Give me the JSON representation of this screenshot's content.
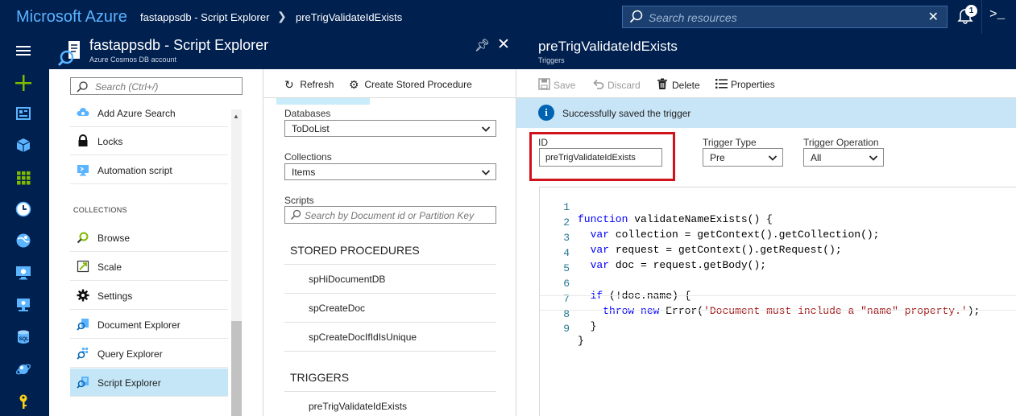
{
  "topbar": {
    "brand": "Microsoft Azure",
    "breadcrumb": [
      "fastappsdb - Script Explorer",
      "preTrigValidateIdExists"
    ],
    "search_placeholder": "Search resources",
    "notification_count": "1"
  },
  "leftnav": {
    "icons": [
      "hamburger-icon",
      "plus-icon",
      "dashboard-icon",
      "cube-icon",
      "grid-icon",
      "clock-icon",
      "globe-icon",
      "monitor-icon",
      "computer-icon",
      "sql-icon",
      "cosmos-icon",
      "key-icon"
    ],
    "colors": {
      "plus": "#7fba00",
      "key": "#fcd116",
      "default": "#5ab4ff"
    }
  },
  "blade1": {
    "title": "fastappsdb - Script Explorer",
    "subtitle": "Azure Cosmos DB account"
  },
  "resource_menu": {
    "search_placeholder": "Search (Ctrl+/)",
    "items_top": [
      {
        "label": "Add Azure Search",
        "icon": "cloud-search-icon"
      },
      {
        "label": "Locks",
        "icon": "lock-icon"
      },
      {
        "label": "Automation script",
        "icon": "automation-icon"
      }
    ],
    "section_label": "COLLECTIONS",
    "items_collections": [
      {
        "label": "Browse",
        "icon": "browse-icon"
      },
      {
        "label": "Scale",
        "icon": "scale-icon"
      },
      {
        "label": "Settings",
        "icon": "gear-icon"
      },
      {
        "label": "Document Explorer",
        "icon": "document-explorer-icon"
      },
      {
        "label": "Query Explorer",
        "icon": "query-explorer-icon"
      },
      {
        "label": "Script Explorer",
        "icon": "script-explorer-icon",
        "active": true
      }
    ]
  },
  "explorer": {
    "refresh_label": "Refresh",
    "create_sp_label": "Create Stored Procedure",
    "databases_label": "Databases",
    "database_value": "ToDoList",
    "collections_label": "Collections",
    "collection_value": "Items",
    "scripts_label": "Scripts",
    "scripts_placeholder": "Search by Document id or Partition Key",
    "stored_procedures_heading": "STORED PROCEDURES",
    "stored_procedures": [
      "spHiDocumentDB",
      "spCreateDoc",
      "spCreateDocIfIdIsUnique"
    ],
    "triggers_heading": "TRIGGERS",
    "triggers": [
      "preTrigValidateIdExists"
    ]
  },
  "blade2": {
    "title": "preTrigValidateIdExists",
    "subtitle": "Triggers",
    "toolbar": {
      "save": "Save",
      "discard": "Discard",
      "delete": "Delete",
      "properties": "Properties"
    },
    "notice": "Successfully saved the trigger",
    "id_label": "ID",
    "id_value": "preTrigValidateIdExists",
    "trigger_type_label": "Trigger Type",
    "trigger_type_value": "Pre",
    "trigger_operation_label": "Trigger Operation",
    "trigger_operation_value": "All"
  },
  "code": {
    "line_numbers": [
      "1",
      "2",
      "3",
      "4",
      "5",
      "6",
      "7",
      "8",
      "9"
    ],
    "lines": [
      "function validateNameExists() {",
      "  var collection = getContext().getCollection();",
      "  var request = getContext().getRequest();",
      "  var doc = request.getBody();",
      "",
      "  if (!doc.name) {",
      "    throw new Error('Document must include a \"name\" property.');",
      "  }",
      "}"
    ]
  },
  "colors": {
    "header_bg": "#002050",
    "brand_blue": "#5ab4ff",
    "active_item": "#c4e6f6",
    "notice_bg": "#c8e5f7",
    "highlight_red": "#d0121a"
  }
}
